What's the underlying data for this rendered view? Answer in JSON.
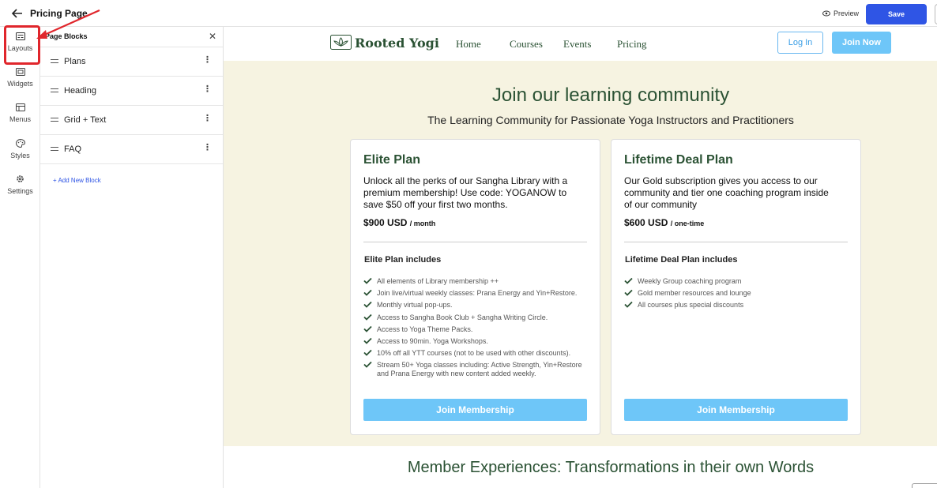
{
  "topbar": {
    "title": "Pricing Page",
    "preview_label": "Preview",
    "save_label": "Save"
  },
  "rail": {
    "items": [
      {
        "label": "Layouts",
        "icon": "layouts-icon"
      },
      {
        "label": "Widgets",
        "icon": "widgets-icon"
      },
      {
        "label": "Menus",
        "icon": "menus-icon"
      },
      {
        "label": "Styles",
        "icon": "palette-icon"
      },
      {
        "label": "Settings",
        "icon": "gear-icon"
      }
    ],
    "highlight_color": "#e0262c"
  },
  "blocks_panel": {
    "title": "Page Blocks",
    "items": [
      {
        "label": "Plans"
      },
      {
        "label": "Heading"
      },
      {
        "label": "Grid + Text"
      },
      {
        "label": "FAQ"
      }
    ],
    "add_label": "+ Add New Block"
  },
  "site": {
    "logo_text": "Rooted Yogi",
    "nav": [
      "Home",
      "Courses",
      "Events",
      "Pricing"
    ],
    "login_label": "Log In",
    "join_label": "Join Now",
    "brand_color": "#2b5234",
    "accent_color": "#6ec6f8",
    "hero_bg": "#f6f3e1"
  },
  "hero": {
    "title": "Join our learning community",
    "subtitle": "The Learning Community for Passionate Yoga Instructors and Practitioners"
  },
  "plans": [
    {
      "name": "Elite Plan",
      "description": "Unlock all the perks of our Sangha Library with a premium membership! Use code: YOGANOW to save $50 off your first two months.",
      "price": "$900 USD",
      "period": "/ month",
      "includes_title": "Elite Plan includes",
      "features": [
        "All elements of Library membership ++",
        "Join live/virtual weekly classes: Prana Energy and Yin+Restore.",
        "Monthly virtual pop-ups.",
        "Access to Sangha Book Club + Sangha Writing Circle.",
        "Access to Yoga Theme Packs.",
        "Access to 90min. Yoga Workshops.",
        "10% off all YTT courses (not to be used with other discounts).",
        "Stream 50+ Yoga classes including: Active Strength, Yin+Restore and Prana Energy with new content added weekly."
      ],
      "button_label": "Join Membership"
    },
    {
      "name": "Lifetime Deal Plan",
      "description": "Our Gold subscription gives you access to our community and tier one coaching program inside of our community",
      "price": "$600 USD",
      "period": "/ one-time",
      "includes_title": "Lifetime Deal Plan includes",
      "features": [
        "Weekly Group coaching program",
        "Gold member resources and lounge",
        "All courses plus special discounts"
      ],
      "button_label": "Join Membership"
    }
  ],
  "section2": {
    "title": "Member Experiences: Transformations in their own Words"
  }
}
